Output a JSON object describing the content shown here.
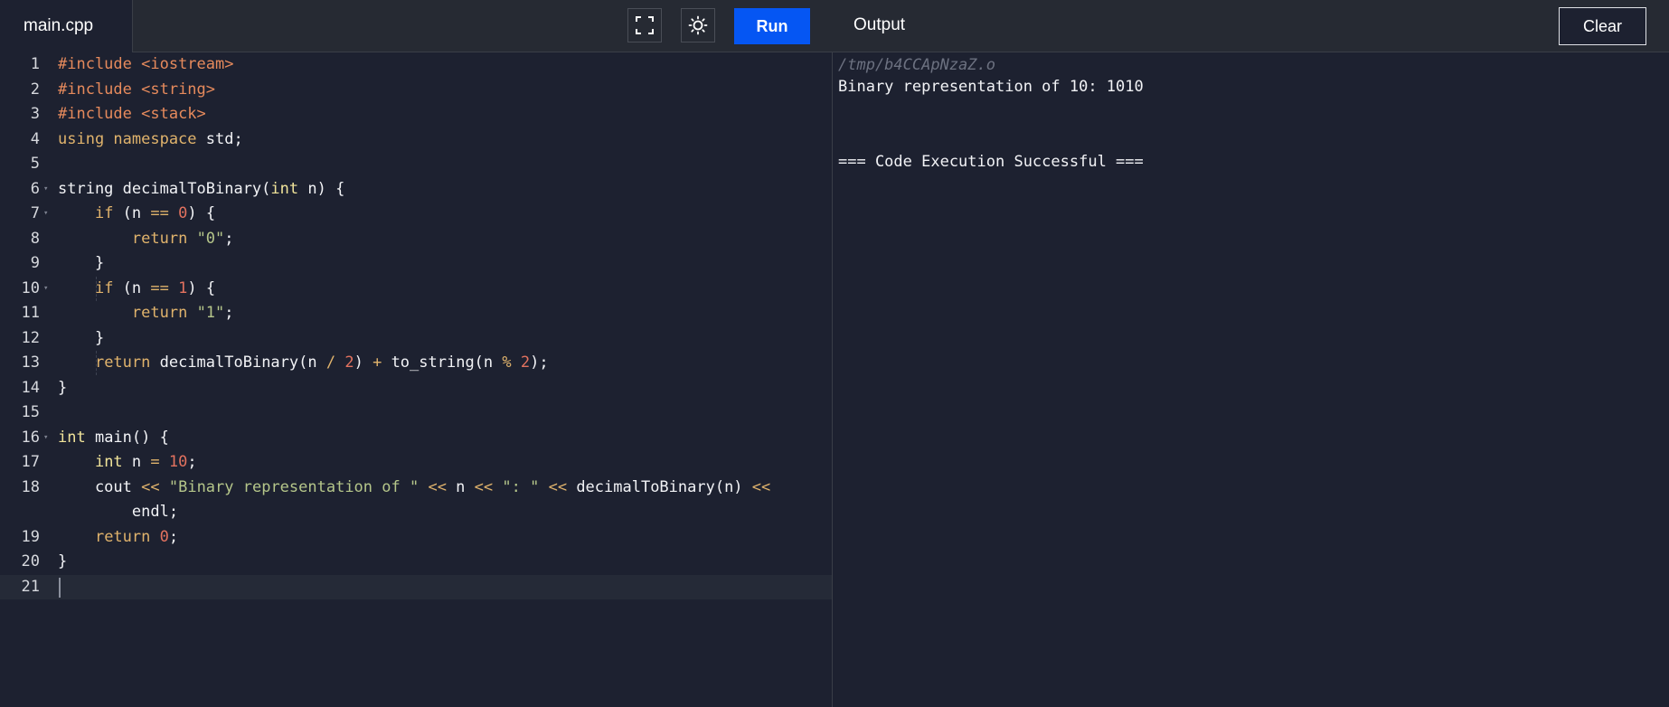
{
  "editor": {
    "tab_label": "main.cpp",
    "run_label": "Run",
    "icons": {
      "fullscreen": "fullscreen-icon",
      "theme": "sun-icon"
    },
    "lines": [
      {
        "n": "1",
        "tokens": [
          {
            "t": "#include ",
            "c": "inc"
          },
          {
            "t": "<iostream>",
            "c": "inc"
          }
        ]
      },
      {
        "n": "2",
        "tokens": [
          {
            "t": "#include ",
            "c": "inc"
          },
          {
            "t": "<string>",
            "c": "inc"
          }
        ]
      },
      {
        "n": "3",
        "tokens": [
          {
            "t": "#include ",
            "c": "inc"
          },
          {
            "t": "<stack>",
            "c": "inc"
          }
        ]
      },
      {
        "n": "4",
        "tokens": [
          {
            "t": "using namespace ",
            "c": "kw"
          },
          {
            "t": "std;",
            "c": ""
          }
        ]
      },
      {
        "n": "5",
        "tokens": []
      },
      {
        "n": "6",
        "fold": true,
        "tokens": [
          {
            "t": "string decimalToBinary(",
            "c": ""
          },
          {
            "t": "int",
            "c": "typ"
          },
          {
            "t": " n) {",
            "c": ""
          }
        ]
      },
      {
        "n": "7",
        "fold": true,
        "tokens": [
          {
            "t": "    ",
            "c": ""
          },
          {
            "t": "if",
            "c": "kw"
          },
          {
            "t": " (n ",
            "c": ""
          },
          {
            "t": "==",
            "c": "op"
          },
          {
            "t": " ",
            "c": ""
          },
          {
            "t": "0",
            "c": "num"
          },
          {
            "t": ") {",
            "c": ""
          }
        ]
      },
      {
        "n": "8",
        "tokens": [
          {
            "t": "        ",
            "c": ""
          },
          {
            "t": "return",
            "c": "kw"
          },
          {
            "t": " ",
            "c": ""
          },
          {
            "t": "\"0\"",
            "c": "str"
          },
          {
            "t": ";",
            "c": ""
          }
        ]
      },
      {
        "n": "9",
        "tokens": [
          {
            "t": "    }",
            "c": ""
          }
        ]
      },
      {
        "n": "10",
        "fold": true,
        "tokens": [
          {
            "t": "    ",
            "c": ""
          },
          {
            "t": "if",
            "c": "kw"
          },
          {
            "t": " (n ",
            "c": ""
          },
          {
            "t": "==",
            "c": "op"
          },
          {
            "t": " ",
            "c": ""
          },
          {
            "t": "1",
            "c": "num"
          },
          {
            "t": ") {",
            "c": ""
          }
        ]
      },
      {
        "n": "11",
        "tokens": [
          {
            "t": "        ",
            "c": ""
          },
          {
            "t": "return",
            "c": "kw"
          },
          {
            "t": " ",
            "c": ""
          },
          {
            "t": "\"1\"",
            "c": "str"
          },
          {
            "t": ";",
            "c": ""
          }
        ]
      },
      {
        "n": "12",
        "tokens": [
          {
            "t": "    }",
            "c": ""
          }
        ]
      },
      {
        "n": "13",
        "tokens": [
          {
            "t": "    ",
            "c": ""
          },
          {
            "t": "return",
            "c": "kw"
          },
          {
            "t": " decimalToBinary(n ",
            "c": ""
          },
          {
            "t": "/",
            "c": "op"
          },
          {
            "t": " ",
            "c": ""
          },
          {
            "t": "2",
            "c": "num"
          },
          {
            "t": ") ",
            "c": ""
          },
          {
            "t": "+",
            "c": "op"
          },
          {
            "t": " to_string(n ",
            "c": ""
          },
          {
            "t": "%",
            "c": "op"
          },
          {
            "t": " ",
            "c": ""
          },
          {
            "t": "2",
            "c": "num"
          },
          {
            "t": ");",
            "c": ""
          }
        ]
      },
      {
        "n": "14",
        "tokens": [
          {
            "t": "}",
            "c": ""
          }
        ]
      },
      {
        "n": "15",
        "tokens": []
      },
      {
        "n": "16",
        "fold": true,
        "tokens": [
          {
            "t": "int",
            "c": "typ"
          },
          {
            "t": " main() {",
            "c": ""
          }
        ]
      },
      {
        "n": "17",
        "tokens": [
          {
            "t": "    ",
            "c": ""
          },
          {
            "t": "int",
            "c": "typ"
          },
          {
            "t": " n ",
            "c": ""
          },
          {
            "t": "=",
            "c": "op"
          },
          {
            "t": " ",
            "c": ""
          },
          {
            "t": "10",
            "c": "num"
          },
          {
            "t": ";",
            "c": ""
          }
        ]
      },
      {
        "n": "18",
        "tokens": [
          {
            "t": "    cout ",
            "c": ""
          },
          {
            "t": "<<",
            "c": "op"
          },
          {
            "t": " ",
            "c": ""
          },
          {
            "t": "\"Binary representation of \"",
            "c": "str"
          },
          {
            "t": " ",
            "c": ""
          },
          {
            "t": "<<",
            "c": "op"
          },
          {
            "t": " n ",
            "c": ""
          },
          {
            "t": "<<",
            "c": "op"
          },
          {
            "t": " ",
            "c": ""
          },
          {
            "t": "\": \"",
            "c": "str"
          },
          {
            "t": " ",
            "c": ""
          },
          {
            "t": "<<",
            "c": "op"
          },
          {
            "t": " decimalToBinary(n) ",
            "c": ""
          },
          {
            "t": "<<",
            "c": "op"
          }
        ]
      },
      {
        "n": "",
        "tokens": [
          {
            "t": "        endl;",
            "c": ""
          }
        ]
      },
      {
        "n": "19",
        "tokens": [
          {
            "t": "    ",
            "c": ""
          },
          {
            "t": "return",
            "c": "kw"
          },
          {
            "t": " ",
            "c": ""
          },
          {
            "t": "0",
            "c": "num"
          },
          {
            "t": ";",
            "c": ""
          }
        ]
      },
      {
        "n": "20",
        "tokens": [
          {
            "t": "}",
            "c": ""
          }
        ]
      },
      {
        "n": "21",
        "tokens": [],
        "active": true
      }
    ]
  },
  "output": {
    "title": "Output",
    "clear_label": "Clear",
    "path": "/tmp/b4CCApNzaZ.o",
    "result": "Binary representation of 10: 1010",
    "status": "=== Code Execution Successful ==="
  },
  "colors": {
    "run_button": "#0556f3",
    "background": "#1d2130",
    "toolbar": "#262a33"
  }
}
